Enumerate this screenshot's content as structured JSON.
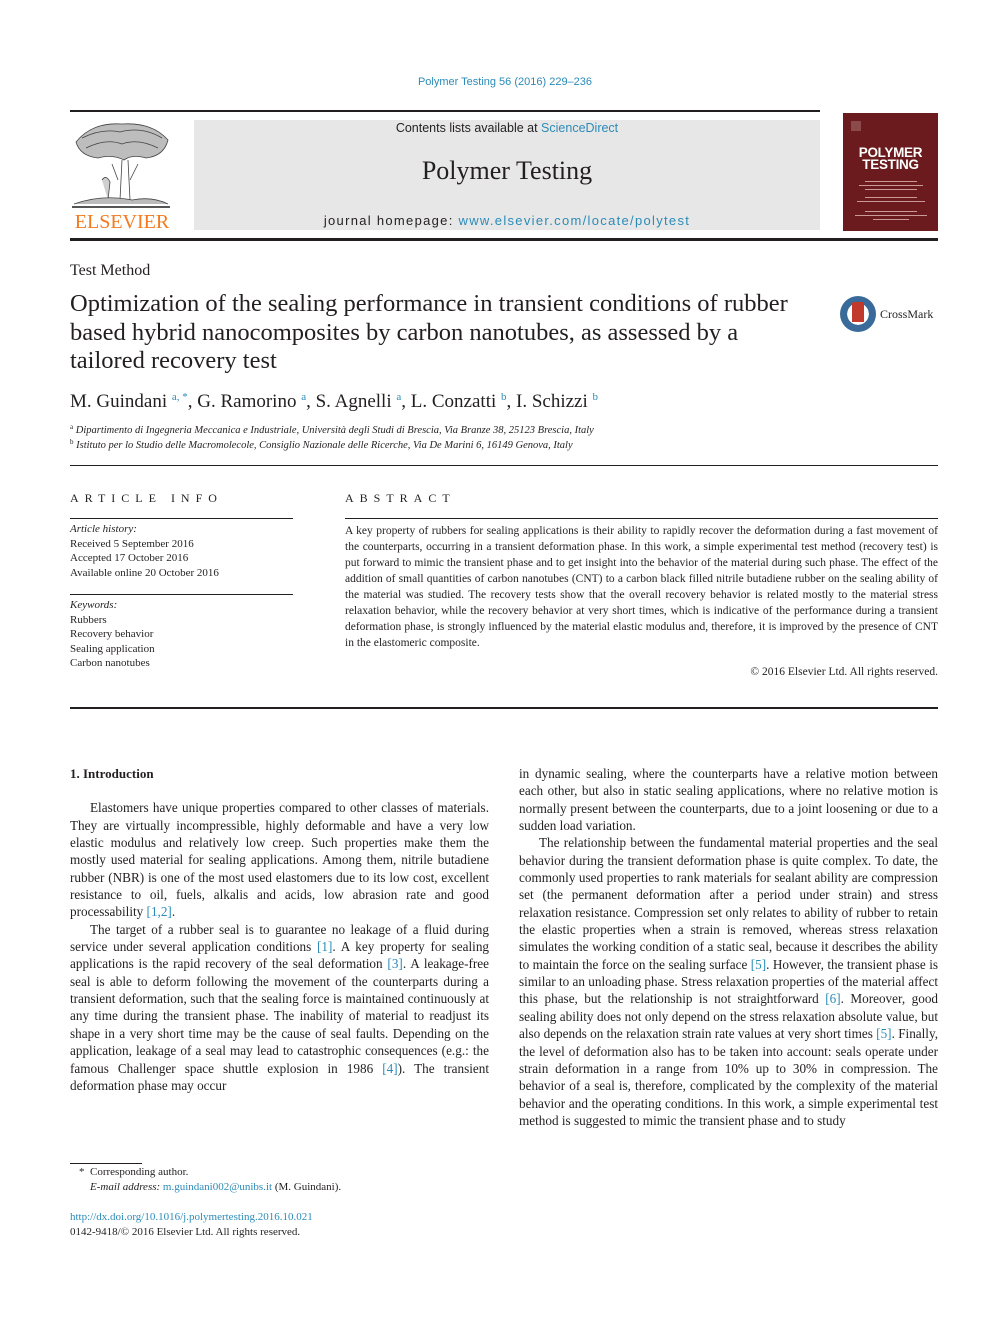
{
  "header": {
    "journal_ref": "Polymer Testing 56 (2016) 229–236",
    "contents_prefix": "Contents lists available at ",
    "contents_link": "ScienceDirect",
    "journal_name": "Polymer Testing",
    "homepage_label": "journal homepage: ",
    "homepage_url": "www.elsevier.com/locate/polytest",
    "publisher_logo_text": "ELSEVIER",
    "cover_title_line1": "POLYMER",
    "cover_title_line2": "TESTING",
    "brand_orange": "#f47a20",
    "link_color": "#2c8bb8",
    "cover_color": "#6b1b1d"
  },
  "article": {
    "type": "Test Method",
    "title": "Optimization of the sealing performance in transient conditions of rubber based hybrid nanocomposites by carbon nanotubes, as assessed by a tailored recovery test",
    "crossmark_label": "CrossMark",
    "authors": [
      {
        "name": "M. Guindani",
        "sup": "a, *"
      },
      {
        "name": "G. Ramorino",
        "sup": "a"
      },
      {
        "name": "S. Agnelli",
        "sup": "a"
      },
      {
        "name": "L. Conzatti",
        "sup": "b"
      },
      {
        "name": "I. Schizzi",
        "sup": "b"
      }
    ],
    "affiliations": [
      {
        "key": "a",
        "text": "Dipartimento di Ingegneria Meccanica e Industriale, Università degli Studi di Brescia, Via Branze 38, 25123 Brescia, Italy"
      },
      {
        "key": "b",
        "text": "Istituto per lo Studio delle Macromolecole, Consiglio Nazionale delle Ricerche, Via De Marini 6, 16149 Genova, Italy"
      }
    ]
  },
  "article_info": {
    "heading": "ARTICLE INFO",
    "history_label": "Article history:",
    "history": [
      "Received 5 September 2016",
      "Accepted 17 October 2016",
      "Available online 20 October 2016"
    ],
    "keywords_label": "Keywords:",
    "keywords": [
      "Rubbers",
      "Recovery behavior",
      "Sealing application",
      "Carbon nanotubes"
    ]
  },
  "abstract": {
    "heading": "ABSTRACT",
    "text": "A key property of rubbers for sealing applications is their ability to rapidly recover the deformation during a fast movement of the counterparts, occurring in a transient deformation phase. In this work, a simple experimental test method (recovery test) is put forward to mimic the transient phase and to get insight into the behavior of the material during such phase. The effect of the addition of small quantities of carbon nanotubes (CNT) to a carbon black filled nitrile butadiene rubber on the sealing ability of the material was studied. The recovery tests show that the overall recovery behavior is related mostly to the material stress relaxation behavior, while the recovery behavior at very short times, which is indicative of the performance during a transient deformation phase, is strongly influenced by the material elastic modulus and, therefore, it is improved by the presence of CNT in the elastomeric composite.",
    "copyright": "© 2016 Elsevier Ltd. All rights reserved."
  },
  "body": {
    "section_heading": "1.  Introduction",
    "left_paragraphs": [
      {
        "parts": [
          {
            "t": "Elastomers have unique properties compared to other classes of materials. They are virtually incompressible, highly deformable and have a very low elastic modulus and relatively low creep. Such properties make them the mostly used material for sealing applications. Among them, nitrile butadiene rubber (NBR) is one of the most used elastomers due to its low cost, excellent resistance to oil, fuels, alkalis and acids, low abrasion rate and good processability "
          },
          {
            "ref": "[1,2]"
          },
          {
            "t": "."
          }
        ]
      },
      {
        "parts": [
          {
            "t": "The target of a rubber seal is to guarantee no leakage of a fluid during service under several application conditions "
          },
          {
            "ref": "[1]"
          },
          {
            "t": ". A key property for sealing applications is the rapid recovery of the seal deformation "
          },
          {
            "ref": "[3]"
          },
          {
            "t": ". A leakage-free seal is able to deform following the movement of the counterparts during a transient deformation, such that the sealing force is maintained continuously at any time during the transient phase. The inability of material to readjust its shape in a very short time may be the cause of seal faults. Depending on the application, leakage of a seal may lead to catastrophic consequences (e.g.: the famous Challenger space shuttle explosion in 1986 "
          },
          {
            "ref": "[4]"
          },
          {
            "t": "). The transient deformation phase may occur"
          }
        ]
      }
    ],
    "right_paragraphs": [
      {
        "noindent": true,
        "parts": [
          {
            "t": "in dynamic sealing, where the counterparts have a relative motion between each other, but also in static sealing applications, where no relative motion is normally present between the counterparts, due to a joint loosening or due to a sudden load variation."
          }
        ]
      },
      {
        "parts": [
          {
            "t": "The relationship between the fundamental material properties and the seal behavior during the transient deformation phase is quite complex. To date, the commonly used properties to rank materials for sealant ability are compression set (the permanent deformation after a period under strain) and stress relaxation resistance. Compression set only relates to ability of rubber to retain the elastic properties when a strain is removed, whereas stress relaxation simulates the working condition of a static seal, because it describes the ability to maintain the force on the sealing surface "
          },
          {
            "ref": "[5]"
          },
          {
            "t": ". However, the transient phase is similar to an unloading phase. Stress relaxation properties of the material affect this phase, but the relationship is not straightforward "
          },
          {
            "ref": "[6]"
          },
          {
            "t": ". Moreover, good sealing ability does not only depend on the stress relaxation absolute value, but also depends on the relaxation strain rate values at very short times "
          },
          {
            "ref": "[5]"
          },
          {
            "t": ". Finally, the level of deformation also has to be taken into account: seals operate under strain deformation in a range from 10% up to 30% in compression. The behavior of a seal is, therefore, complicated by the complexity of the material behavior and the operating conditions. In this work, a simple experimental test method is suggested to mimic the transient phase and to study"
          }
        ]
      }
    ]
  },
  "footer": {
    "corresponding_mark": "*",
    "corresponding_label": "Corresponding author.",
    "email_label": "E-mail address:",
    "email": "m.guindani002@unibs.it",
    "email_owner": " (M. Guindani).",
    "doi": "http://dx.doi.org/10.1016/j.polymertesting.2016.10.021",
    "issn": "0142-9418/© 2016 Elsevier Ltd. All rights reserved."
  }
}
